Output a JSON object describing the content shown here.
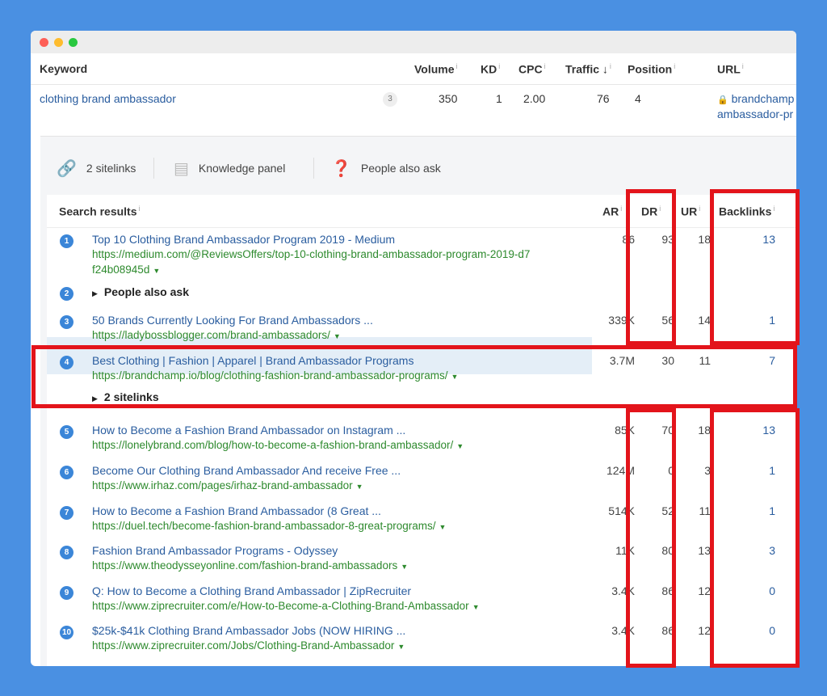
{
  "keyword_table": {
    "headers": {
      "keyword": "Keyword",
      "volume": "Volume",
      "kd": "KD",
      "cpc": "CPC",
      "traffic": "Traffic",
      "position": "Position",
      "url": "URL",
      "info": "i"
    },
    "row": {
      "keyword": "clothing brand ambassador",
      "count": "3",
      "volume": "350",
      "kd": "1",
      "cpc": "2.00",
      "traffic": "76",
      "position": "4",
      "url_line1": "brandchamp",
      "url_line2": "ambassador-pr"
    }
  },
  "features": {
    "sitelinks": "2 sitelinks",
    "knowledge_panel": "Knowledge panel",
    "people_also_ask": "People also ask"
  },
  "serp": {
    "headers": {
      "search_results": "Search results",
      "ar": "AR",
      "dr": "DR",
      "ur": "UR",
      "backlinks": "Backlinks"
    },
    "rows": [
      {
        "n": "1",
        "title": "Top 10 Clothing Brand Ambassador Program 2019 - Medium",
        "url": "https://medium.com/@ReviewsOffers/top-10-clothing-brand-ambassador-program-2019-d7",
        "url2": "f24b08945d",
        "ar": "86",
        "dr": "93",
        "ur": "18",
        "bl": "13"
      },
      {
        "n": "2",
        "sub": "People also ask"
      },
      {
        "n": "3",
        "title": "50 Brands Currently Looking For Brand Ambassadors ...",
        "url": "https://ladybossblogger.com/brand-ambassadors/",
        "ar": "339K",
        "dr": "56",
        "ur": "14",
        "bl": "1"
      },
      {
        "n": "4",
        "title": "Best Clothing | Fashion | Apparel | Brand Ambassador Programs",
        "url": "https://brandchamp.io/blog/clothing-fashion-brand-ambassador-programs/",
        "ar": "3.7M",
        "dr": "30",
        "ur": "11",
        "bl": "7",
        "sub": "2 sitelinks"
      },
      {
        "n": "5",
        "title": "How to Become a Fashion Brand Ambassador on Instagram ...",
        "url": "https://lonelybrand.com/blog/how-to-become-a-fashion-brand-ambassador/",
        "ar": "85K",
        "dr": "70",
        "ur": "18",
        "bl": "13"
      },
      {
        "n": "6",
        "title": "Become Our Clothing Brand Ambassador And receive Free ...",
        "url": "https://www.irhaz.com/pages/irhaz-brand-ambassador",
        "ar": "124M",
        "dr": "0",
        "ur": "3",
        "bl": "1"
      },
      {
        "n": "7",
        "title": "How to Become a Fashion Brand Ambassador (8 Great ...",
        "url": "https://duel.tech/become-fashion-brand-ambassador-8-great-programs/",
        "ar": "514K",
        "dr": "52",
        "ur": "11",
        "bl": "1"
      },
      {
        "n": "8",
        "title": "Fashion Brand Ambassador Programs - Odyssey",
        "url": "https://www.theodysseyonline.com/fashion-brand-ambassadors",
        "ar": "11K",
        "dr": "80",
        "ur": "13",
        "bl": "3"
      },
      {
        "n": "9",
        "title": "Q: How to Become a Clothing Brand Ambassador | ZipRecruiter",
        "url": "https://www.ziprecruiter.com/e/How-to-Become-a-Clothing-Brand-Ambassador",
        "ar": "3.4K",
        "dr": "86",
        "ur": "12",
        "bl": "0"
      },
      {
        "n": "10",
        "title": "$25k-$41k Clothing Brand Ambassador Jobs (NOW HIRING ...",
        "url": "https://www.ziprecruiter.com/Jobs/Clothing-Brand-Ambassador",
        "ar": "3.4K",
        "dr": "86",
        "ur": "12",
        "bl": "0"
      }
    ]
  },
  "colors": {
    "highlight": "#e3141b",
    "background": "#4a90e2",
    "link": "#2a5d9f",
    "url": "#2e8a2e"
  }
}
